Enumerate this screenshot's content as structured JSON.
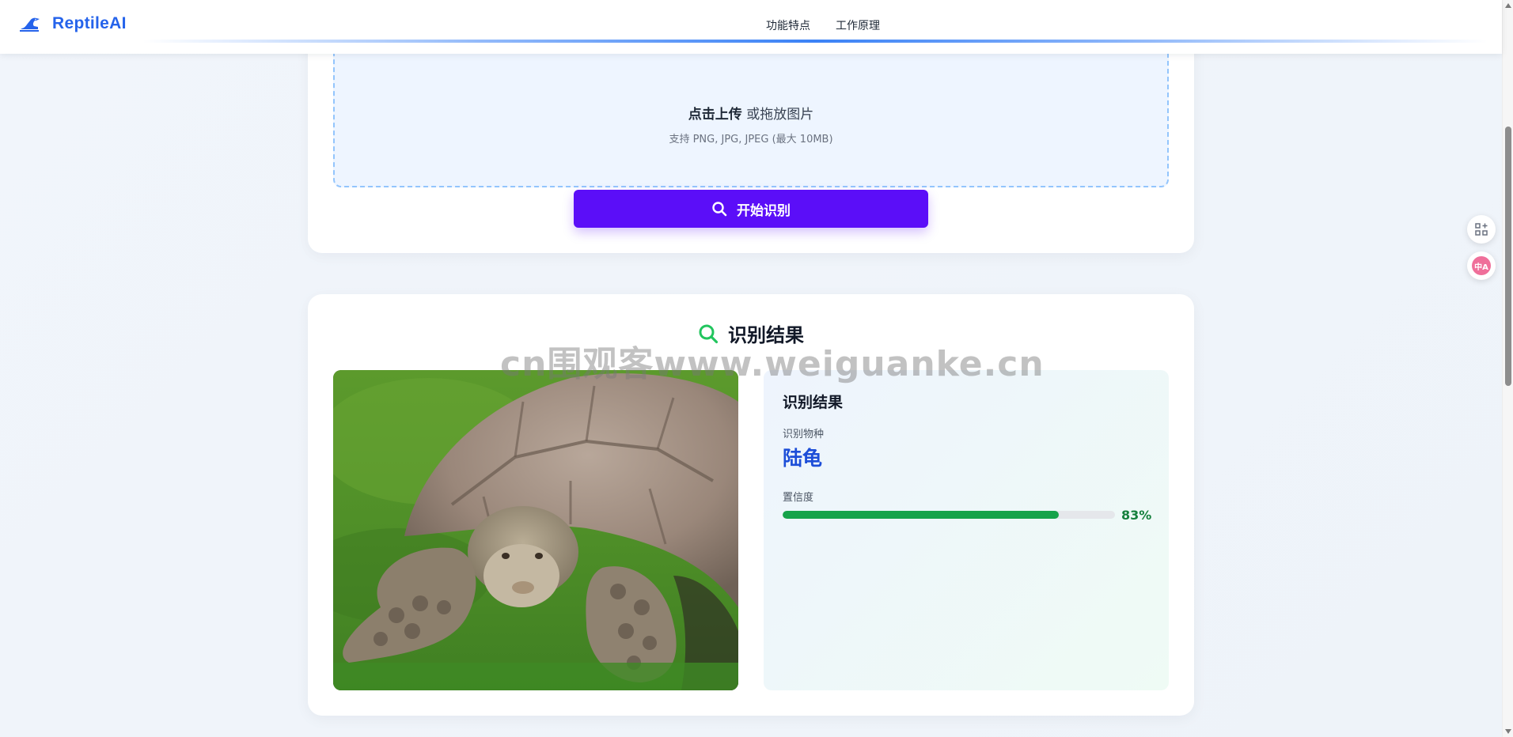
{
  "header": {
    "brand": "ReptileAI",
    "nav": [
      {
        "label": "功能特点"
      },
      {
        "label": "工作原理"
      }
    ]
  },
  "upload": {
    "title_strong": "点击上传",
    "title_rest": " 或拖放图片",
    "hint": "支持 PNG, JPG, JPEG (最大 10MB)",
    "start_button": "开始识别"
  },
  "result": {
    "heading": "识别结果",
    "panel_title": "识别结果",
    "species_label": "识别物种",
    "species_value": "陆龟",
    "confidence_label": "置信度",
    "confidence_percent": 83,
    "confidence_text": "83%"
  },
  "watermark": "cn围观客www.weiguanke.cn",
  "side_tools": [
    {
      "icon": "grid-plus-icon"
    },
    {
      "icon": "translate-icon",
      "badge": "中A"
    }
  ],
  "colors": {
    "brand": "#2563eb",
    "button": "#5b0ef8",
    "success": "#16a34a",
    "species": "#1d4ed8"
  }
}
